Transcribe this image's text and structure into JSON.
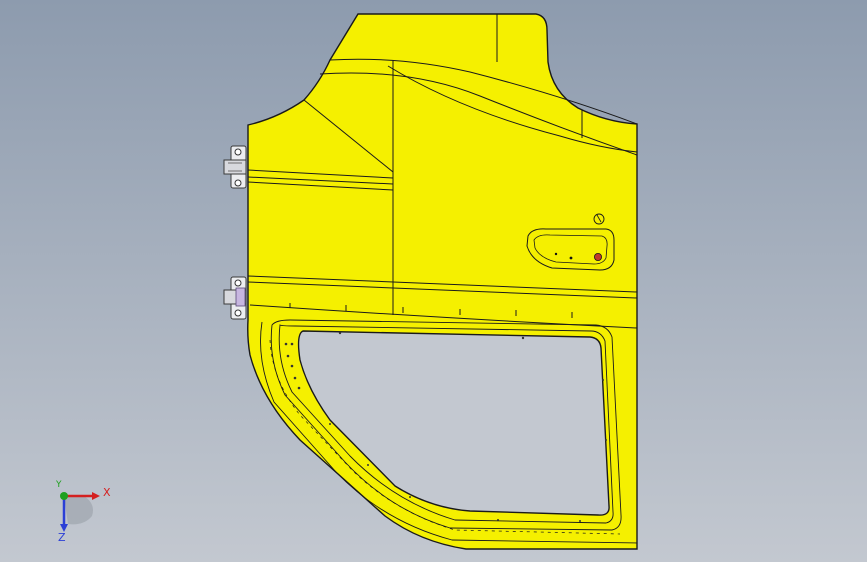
{
  "viewport": {
    "background_top": "#8d9bae",
    "background_bottom": "#c3c8d0"
  },
  "model": {
    "part": "truck-cab-door-panel",
    "fill_color": "#f5f000",
    "edge_color": "#1a1a1a",
    "handle_button_color": "#c0392b"
  },
  "triad": {
    "x_label": "X",
    "y_label": "Y",
    "z_label": "Z",
    "x_color": "#d42020",
    "y_color": "#1fa01f",
    "z_color": "#2b3fd6"
  }
}
